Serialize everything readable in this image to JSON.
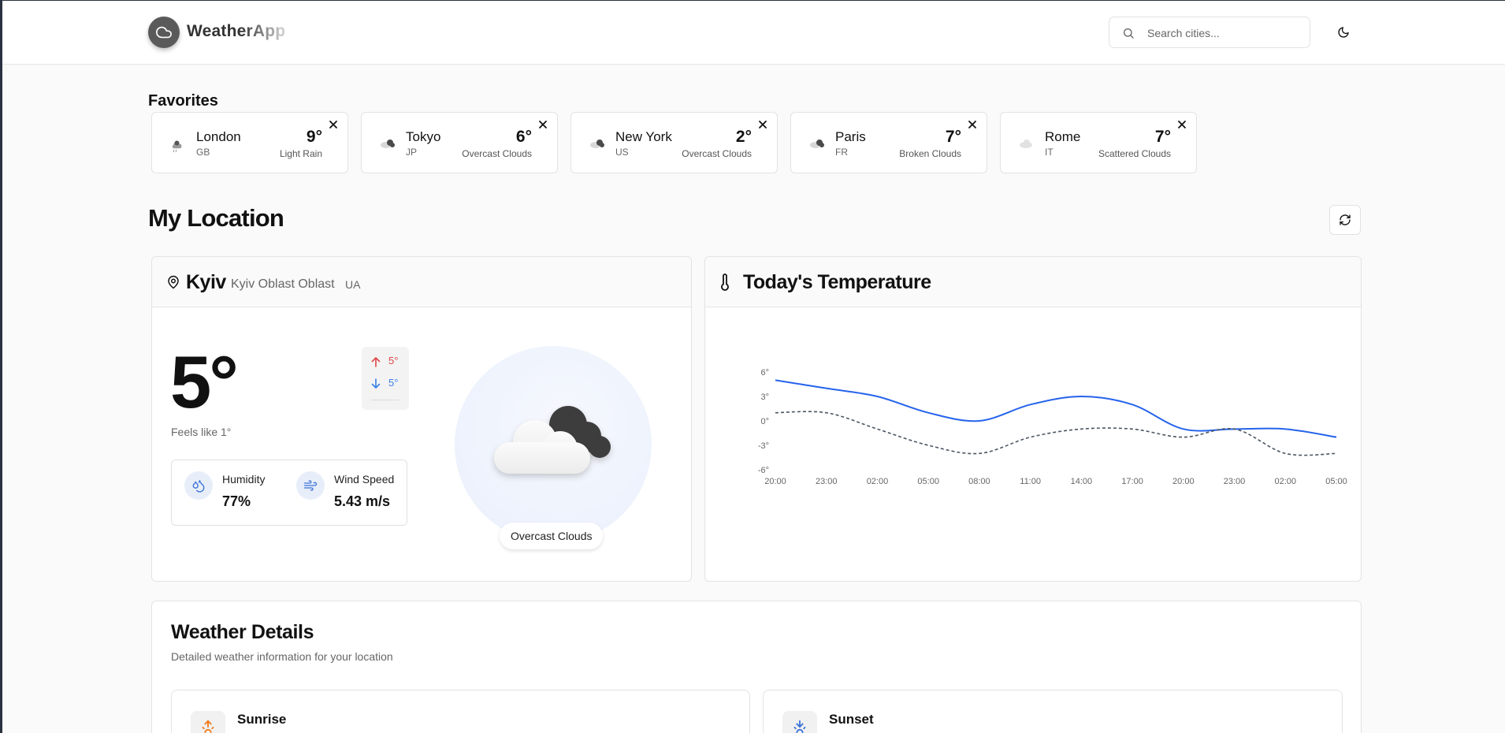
{
  "app": {
    "title": "WeatherApp"
  },
  "search": {
    "placeholder": "Search cities..."
  },
  "favorites": {
    "title": "Favorites",
    "items": [
      {
        "name": "London",
        "country": "GB",
        "temp": "9°",
        "desc": "Light Rain",
        "icon": "rain-cloud-icon"
      },
      {
        "name": "Tokyo",
        "country": "JP",
        "temp": "6°",
        "desc": "Overcast Clouds",
        "icon": "overcast-cloud-icon"
      },
      {
        "name": "New York",
        "country": "US",
        "temp": "2°",
        "desc": "Overcast Clouds",
        "icon": "overcast-cloud-icon"
      },
      {
        "name": "Paris",
        "country": "FR",
        "temp": "7°",
        "desc": "Broken Clouds",
        "icon": "broken-cloud-icon"
      },
      {
        "name": "Rome",
        "country": "IT",
        "temp": "7°",
        "desc": "Scattered Clouds",
        "icon": "scattered-cloud-icon"
      }
    ]
  },
  "location": {
    "section_title": "My Location",
    "city": "Kyiv",
    "region": "Kyiv Oblast Oblast",
    "country": "UA",
    "temp": "5°",
    "feels_like": "Feels like 1°",
    "high": "5°",
    "low": "5°",
    "humidity_label": "Humidity",
    "humidity": "77%",
    "wind_label": "Wind Speed",
    "wind": "5.43 m/s",
    "condition": "Overcast Clouds"
  },
  "chart_data": {
    "type": "line",
    "title": "Today's Temperature",
    "x": [
      "20:00",
      "23:00",
      "02:00",
      "05:00",
      "08:00",
      "11:00",
      "14:00",
      "17:00",
      "20:00",
      "23:00",
      "02:00",
      "05:00"
    ],
    "xlabel": "",
    "ylabel": "",
    "ylim": [
      -6,
      6
    ],
    "yticks": [
      "6°",
      "3°",
      "0°",
      "-3°",
      "-6°"
    ],
    "grid": false,
    "series": [
      {
        "values": [
          5,
          4,
          3,
          1,
          0,
          2,
          3,
          2,
          -1,
          -1,
          -1,
          -2
        ],
        "color": "#2563eb",
        "style": "solid"
      },
      {
        "values": [
          1,
          1,
          -1,
          -3,
          -4,
          -2,
          -1,
          -1,
          -2,
          -1,
          -4,
          -4
        ],
        "color": "#4b5563",
        "style": "dashed"
      }
    ]
  },
  "details": {
    "title": "Weather Details",
    "subtitle": "Detailed weather information for your location",
    "sunrise_label": "Sunrise",
    "sunset_label": "Sunset"
  },
  "colors": {
    "accent": "#2563eb",
    "high": "#e04747",
    "low": "#3a80e8"
  }
}
